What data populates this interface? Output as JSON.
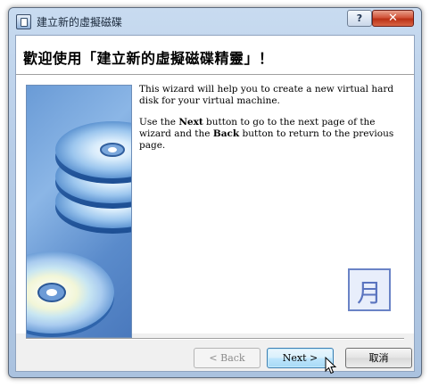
{
  "window": {
    "title": "建立新的虛擬磁碟",
    "help_label": "?",
    "close_label": "✕"
  },
  "header": {
    "title": "歡迎使用「建立新的虛擬磁碟精靈」！"
  },
  "content": {
    "paragraph1": "This wizard will help you to create a new virtual hard disk for your virtual machine.",
    "paragraph2_parts": {
      "a": "Use the ",
      "b": "Next",
      "c": " button to go to the next page of the wizard and the ",
      "d": "Back",
      "e": " button to return to the previous page."
    },
    "logo_glyph": "月"
  },
  "buttons": {
    "back": "< Back",
    "next": "Next >",
    "cancel": "取消"
  },
  "icons": {
    "app": "virtualbox-disk-icon",
    "help": "help-icon",
    "close": "close-icon",
    "side_art": "stacked-discs-illustration",
    "cursor": "mouse-pointer-icon"
  }
}
